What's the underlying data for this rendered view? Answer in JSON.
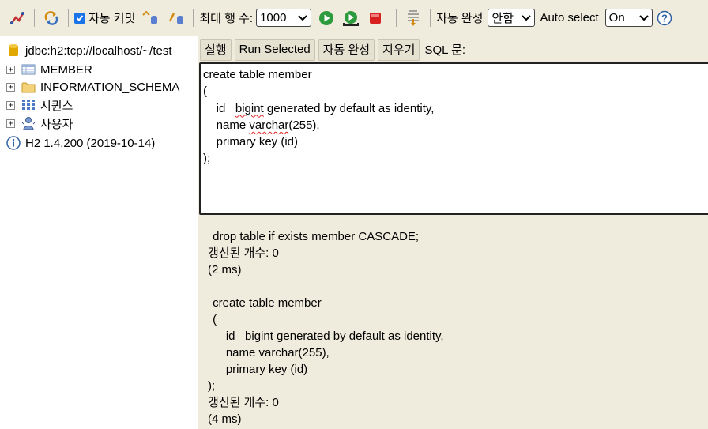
{
  "toolbar": {
    "auto_commit_label": "자동 커밋",
    "max_rows_label": "최대 행 수:",
    "max_rows_value": "1000",
    "auto_complete_label": "자동 완성",
    "auto_complete_value": "안함",
    "auto_select_label": "Auto select",
    "auto_select_value": "On"
  },
  "tree": {
    "connection": "jdbc:h2:tcp://localhost/~/test",
    "items": [
      {
        "label": "MEMBER",
        "icon": "table-icon"
      },
      {
        "label": "INFORMATION_SCHEMA",
        "icon": "folder-icon"
      },
      {
        "label": "시퀀스",
        "icon": "sequence-icon"
      },
      {
        "label": "사용자",
        "icon": "users-icon"
      }
    ],
    "version": "H2 1.4.200 (2019-10-14)"
  },
  "buttons": {
    "run": "실행",
    "run_selected": "Run Selected",
    "auto_complete": "자동 완성",
    "clear": "지우기",
    "sql_label": "SQL 문:"
  },
  "editor": {
    "lines": [
      "create table member",
      "(",
      "    id   bigint generated by default as identity,",
      "    name varchar(255),",
      "    primary key (id)",
      ");"
    ]
  },
  "results": {
    "block1": {
      "sql": " drop table if exists member CASCADE;",
      "updated": "갱신된 개수: 0",
      "time": "(2 ms)"
    },
    "block2": {
      "sql_lines": [
        " create table member",
        " (",
        "     id   bigint generated by default as identity,",
        "     name varchar(255),",
        "     primary key (id)",
        ");"
      ],
      "updated": "갱신된 개수: 0",
      "time": "(4 ms)"
    }
  },
  "colors": {
    "toolbar_bg": "#f0ecdd",
    "panel_bg": "#f0ecdd",
    "checkbox_accent": "#1a73e8",
    "run_green": "#2e9a3e",
    "stop_red": "#d82020"
  }
}
